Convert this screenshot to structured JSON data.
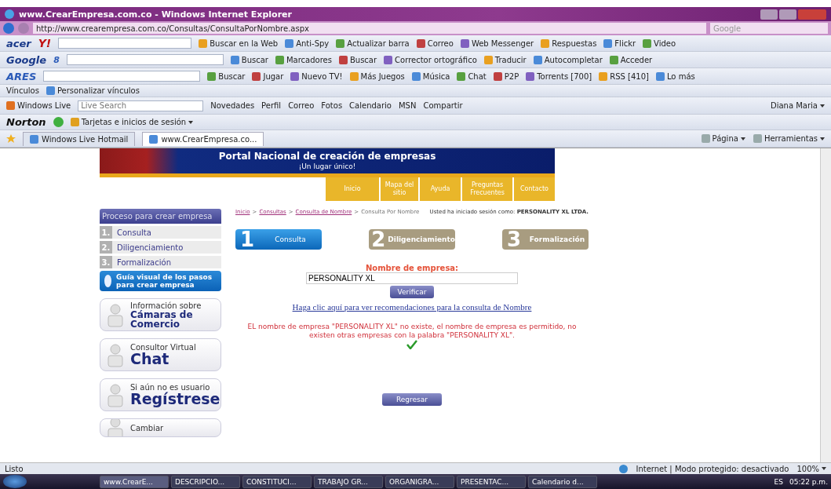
{
  "window": {
    "title": "www.CrearEmpresa.com.co - Windows Internet Explorer"
  },
  "address_bar": {
    "url": "http://www.crearempresa.com.co/Consultas/ConsultaPorNombre.aspx",
    "search_placeholder": "Google"
  },
  "toolbars": [
    {
      "brand": "acer",
      "brand2": "Y!",
      "items": [
        "Buscar en la Web",
        "Anti-Spy",
        "Actualizar barra",
        "Correo",
        "Web Messenger",
        "Respuestas",
        "Flickr",
        "Video"
      ]
    },
    {
      "brand": "Google",
      "brand2": "8",
      "items": [
        "Buscar",
        "Marcadores",
        "Buscar",
        "Corrector ortográfico",
        "Traducir",
        "Autocompletar",
        "Acceder"
      ]
    },
    {
      "brand": "ARES",
      "items": [
        "Buscar",
        "Jugar",
        "Nuevo TV!",
        "Más Juegos",
        "Música",
        "Chat",
        "P2P",
        "Torrents [700]",
        "RSS [410]",
        "Lo más"
      ]
    }
  ],
  "links_bar": {
    "label": "Vínculos",
    "items": [
      "Personalizar vínculos"
    ]
  },
  "live_bar": {
    "brand": "Windows Live",
    "search_placeholder": "Live Search",
    "items": [
      "Novedades",
      "Perfil",
      "Correo",
      "Fotos",
      "Calendario",
      "MSN",
      "Compartir"
    ],
    "user": "Diana Maria"
  },
  "norton_bar": {
    "brand": "Norton",
    "items": [
      "Tarjetas e inicios de sesión"
    ]
  },
  "tabs": [
    {
      "label": "Windows Live Hotmail",
      "selected": false
    },
    {
      "label": "www.CrearEmpresa.co...",
      "selected": true
    }
  ],
  "command_bar": [
    "Página",
    "Herramientas"
  ],
  "site": {
    "banner_title": "Portal Nacional de creación de empresas",
    "banner_subtitle": "¡Un lugar único!",
    "nav": [
      "Inicio",
      "Mapa del sitio",
      "Ayuda",
      "Preguntas Frecuentes",
      "Contacto"
    ],
    "sidebar": {
      "title": "Proceso para crear empresa",
      "steps": [
        {
          "num": "1.",
          "label": "Consulta"
        },
        {
          "num": "2.",
          "label": "Diligenciamiento"
        },
        {
          "num": "3.",
          "label": "Formalización"
        }
      ],
      "guide": "Guía visual de los pasos para crear empresa",
      "cards": [
        {
          "small": "Información sobre",
          "big": "Cámaras de Comercio"
        },
        {
          "small": "Consultor Virtual",
          "big": "Chat"
        },
        {
          "small": "Si aún no es usuario",
          "big": "Regístrese"
        },
        {
          "small": "Cambiar"
        }
      ]
    },
    "breadcrumb": {
      "separator": ">",
      "links": [
        "Inicio",
        "Consultas",
        "Consulta de Nombre"
      ],
      "current": "Consulta Por Nombre"
    },
    "session": "Usted ha iniciado sesión como: **PERSONALITY XL LTDA.**",
    "steps": [
      {
        "num": "1",
        "label": "Consulta",
        "selected": true
      },
      {
        "num": "2",
        "label": "Diligenciamiento",
        "selected": false
      },
      {
        "num": "3",
        "label": "Formalización",
        "selected": false
      }
    ],
    "form": {
      "label": "Nombre de empresa:",
      "value": "PERSONALITY XL",
      "button": "Verificar"
    },
    "help_link": "Haga clic aquí para ver recomendaciones para la consulta de Nombre",
    "message": "EL nombre de empresa \"PERSONALITY XL\" no existe, el nombre de empresa es permitido, no existen otras empresas con la palabra \"PERSONALITY XL\".",
    "back_button": "Regresar"
  },
  "status_bar": {
    "text": "Listo",
    "zone": "Internet | Modo protegido: desactivado",
    "zoom": "100%"
  },
  "taskbar": {
    "items": [
      {
        "label": "www.CrearE...",
        "selected": true
      },
      {
        "label": "DESCRIPCIO...",
        "selected": false
      },
      {
        "label": "CONSTITUCI...",
        "selected": false
      },
      {
        "label": "TRABAJO GR...",
        "selected": false
      },
      {
        "label": "ORGANIGRA...",
        "selected": false
      },
      {
        "label": "PRESENTAC...",
        "selected": false
      },
      {
        "label": "Calendario d...",
        "selected": false
      }
    ],
    "lang": "ES",
    "clock": "05:22 p.m."
  }
}
